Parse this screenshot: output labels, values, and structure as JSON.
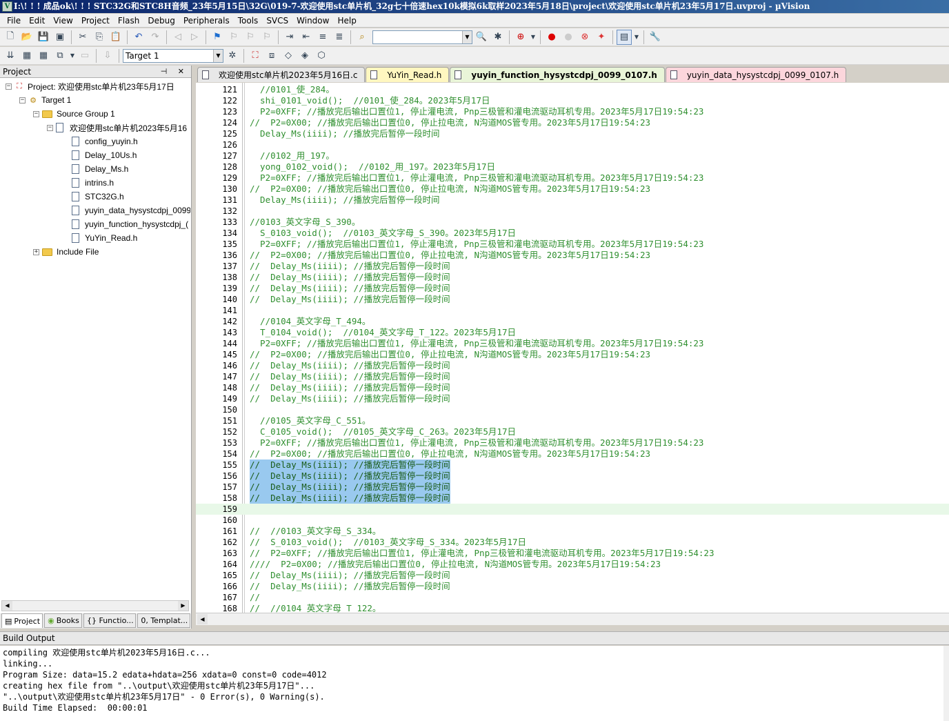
{
  "window": {
    "title": "I:\\! ! ! 成品ok\\! ! ! STC32G和STC8H音频_23年5月15日\\32G\\019-7-欢迎使用stc单片机_32g七十倍速hex10k模拟6k取样2023年5月18日\\project\\欢迎使用stc单片机23年5月17日.uvproj - µVision",
    "icon_text": "V"
  },
  "menu": [
    "File",
    "Edit",
    "View",
    "Project",
    "Flash",
    "Debug",
    "Peripherals",
    "Tools",
    "SVCS",
    "Window",
    "Help"
  ],
  "toolbar": {
    "target": "Target 1",
    "search_value": ""
  },
  "project_panel": {
    "title": "Project",
    "controls": "⊣ ✕",
    "tree": {
      "root": "Project: 欢迎使用stc单片机23年5月17日",
      "target": "Target 1",
      "group": "Source Group 1",
      "source_file": "欢迎使用stc单片机2023年5月16",
      "headers": [
        "config_yuyin.h",
        "Delay_10Us.h",
        "Delay_Ms.h",
        "intrins.h",
        "STC32G.h",
        "yuyin_data_hysystcdpj_0099",
        "yuyin_function_hysystcdpj_(",
        "YuYin_Read.h"
      ],
      "include": "Include File"
    },
    "tabs": [
      "Project",
      "Books",
      "{} Functio...",
      "0, Templat..."
    ]
  },
  "editor_tabs": [
    "欢迎使用stc单片机2023年5月16日.c",
    "YuYin_Read.h",
    "yuyin_function_hysystcdpj_0099_0107.h",
    "yuyin_data_hysystcdpj_0099_0107.h"
  ],
  "editor_tab_colors": [
    "#e8e8e8",
    "#fff7c0",
    "#e9f5d8",
    "#fcd6dc"
  ],
  "code_lines": [
    {
      "n": "121",
      "t": "  //0101_使_284。"
    },
    {
      "n": "122",
      "t": "  shi_0101_void();  //0101_使_284。2023年5月17日"
    },
    {
      "n": "123",
      "t": "  P2=0XFF; //播放完后输出口置位1, 停止灌电流, Pnp三极管和灌电流驱动耳机专用。2023年5月17日19:54:23"
    },
    {
      "n": "124",
      "t": "//  P2=0X00; //播放完后输出口置位0, 停止拉电流, N沟道MOS管专用。2023年5月17日19:54:23"
    },
    {
      "n": "125",
      "t": "  Delay_Ms(iiii); //播放完后暂停一段时间"
    },
    {
      "n": "126",
      "t": ""
    },
    {
      "n": "127",
      "t": "  //0102_用_197。"
    },
    {
      "n": "128",
      "t": "  yong_0102_void();  //0102_用_197。2023年5月17日"
    },
    {
      "n": "129",
      "t": "  P2=0XFF; //播放完后输出口置位1, 停止灌电流, Pnp三极管和灌电流驱动耳机专用。2023年5月17日19:54:23"
    },
    {
      "n": "130",
      "t": "//  P2=0X00; //播放完后输出口置位0, 停止拉电流, N沟道MOS管专用。2023年5月17日19:54:23"
    },
    {
      "n": "131",
      "t": "  Delay_Ms(iiii); //播放完后暂停一段时间"
    },
    {
      "n": "132",
      "t": ""
    },
    {
      "n": "133",
      "t": "//0103_英文字母_S_390。"
    },
    {
      "n": "134",
      "t": "  S_0103_void();  //0103_英文字母_S_390。2023年5月17日"
    },
    {
      "n": "135",
      "t": "  P2=0XFF; //播放完后输出口置位1, 停止灌电流, Pnp三极管和灌电流驱动耳机专用。2023年5月17日19:54:23"
    },
    {
      "n": "136",
      "t": "//  P2=0X00; //播放完后输出口置位0, 停止拉电流, N沟道MOS管专用。2023年5月17日19:54:23"
    },
    {
      "n": "137",
      "t": "//  Delay_Ms(iiii); //播放完后暂停一段时间"
    },
    {
      "n": "138",
      "t": "//  Delay_Ms(iiii); //播放完后暂停一段时间"
    },
    {
      "n": "139",
      "t": "//  Delay_Ms(iiii); //播放完后暂停一段时间"
    },
    {
      "n": "140",
      "t": "//  Delay_Ms(iiii); //播放完后暂停一段时间"
    },
    {
      "n": "141",
      "t": ""
    },
    {
      "n": "142",
      "t": "  //0104_英文字母_T_494。"
    },
    {
      "n": "143",
      "t": "  T_0104_void();  //0104_英文字母_T_122。2023年5月17日"
    },
    {
      "n": "144",
      "t": "  P2=0XFF; //播放完后输出口置位1, 停止灌电流, Pnp三极管和灌电流驱动耳机专用。2023年5月17日19:54:23"
    },
    {
      "n": "145",
      "t": "//  P2=0X00; //播放完后输出口置位0, 停止拉电流, N沟道MOS管专用。2023年5月17日19:54:23"
    },
    {
      "n": "146",
      "t": "//  Delay_Ms(iiii); //播放完后暂停一段时间"
    },
    {
      "n": "147",
      "t": "//  Delay_Ms(iiii); //播放完后暂停一段时间"
    },
    {
      "n": "148",
      "t": "//  Delay_Ms(iiii); //播放完后暂停一段时间"
    },
    {
      "n": "149",
      "t": "//  Delay_Ms(iiii); //播放完后暂停一段时间"
    },
    {
      "n": "150",
      "t": ""
    },
    {
      "n": "151",
      "t": "  //0105_英文字母_C_551。"
    },
    {
      "n": "152",
      "t": "  C_0105_void();  //0105_英文字母_C_263。2023年5月17日"
    },
    {
      "n": "153",
      "t": "  P2=0XFF; //播放完后输出口置位1, 停止灌电流, Pnp三极管和灌电流驱动耳机专用。2023年5月17日19:54:23"
    },
    {
      "n": "154",
      "t": "//  P2=0X00; //播放完后输出口置位0, 停止拉电流, N沟道MOS管专用。2023年5月17日19:54:23"
    },
    {
      "n": "155",
      "t": "//  Delay_Ms(iiii); //播放完后暂停一段时间"
    },
    {
      "n": "156",
      "t": "//  Delay_Ms(iiii); //播放完后暂停一段时间"
    },
    {
      "n": "157",
      "t": "//  Delay_Ms(iiii); //播放完后暂停一段时间"
    },
    {
      "n": "158",
      "t": "//  Delay_Ms(iiii); //播放完后暂停一段时间"
    },
    {
      "n": "159",
      "t": ""
    },
    {
      "n": "160",
      "t": ""
    },
    {
      "n": "161",
      "t": "//  //0103_英文字母_S_334。"
    },
    {
      "n": "162",
      "t": "//  S_0103_void();  //0103_英文字母_S_334。2023年5月17日"
    },
    {
      "n": "163",
      "t": "//  P2=0XFF; //播放完后输出口置位1, 停止灌电流, Pnp三极管和灌电流驱动耳机专用。2023年5月17日19:54:23"
    },
    {
      "n": "164",
      "t": "////  P2=0X00; //播放完后输出口置位0, 停止拉电流, N沟道MOS管专用。2023年5月17日19:54:23"
    },
    {
      "n": "165",
      "t": "//  Delay_Ms(iiii); //播放完后暂停一段时间"
    },
    {
      "n": "166",
      "t": "//  Delay_Ms(iiii); //播放完后暂停一段时间"
    },
    {
      "n": "167",
      "t": "//"
    },
    {
      "n": "168",
      "t": "//  //0104_英文字母_T_122。"
    }
  ],
  "selected_lines": [
    "155",
    "156",
    "157",
    "158"
  ],
  "current_line": "159",
  "build": {
    "title": "Build Output",
    "lines": [
      "compiling 欢迎使用stc单片机2023年5月16日.c...",
      "linking...",
      "Program Size: data=15.2 edata+hdata=256 xdata=0 const=0 code=4012",
      "creating hex file from \"..\\output\\欢迎使用stc单片机23年5月17日\"...",
      "\"..\\output\\欢迎使用stc单片机23年5月17日\" - 0 Error(s), 0 Warning(s).",
      "Build Time Elapsed:  00:00:01"
    ]
  }
}
